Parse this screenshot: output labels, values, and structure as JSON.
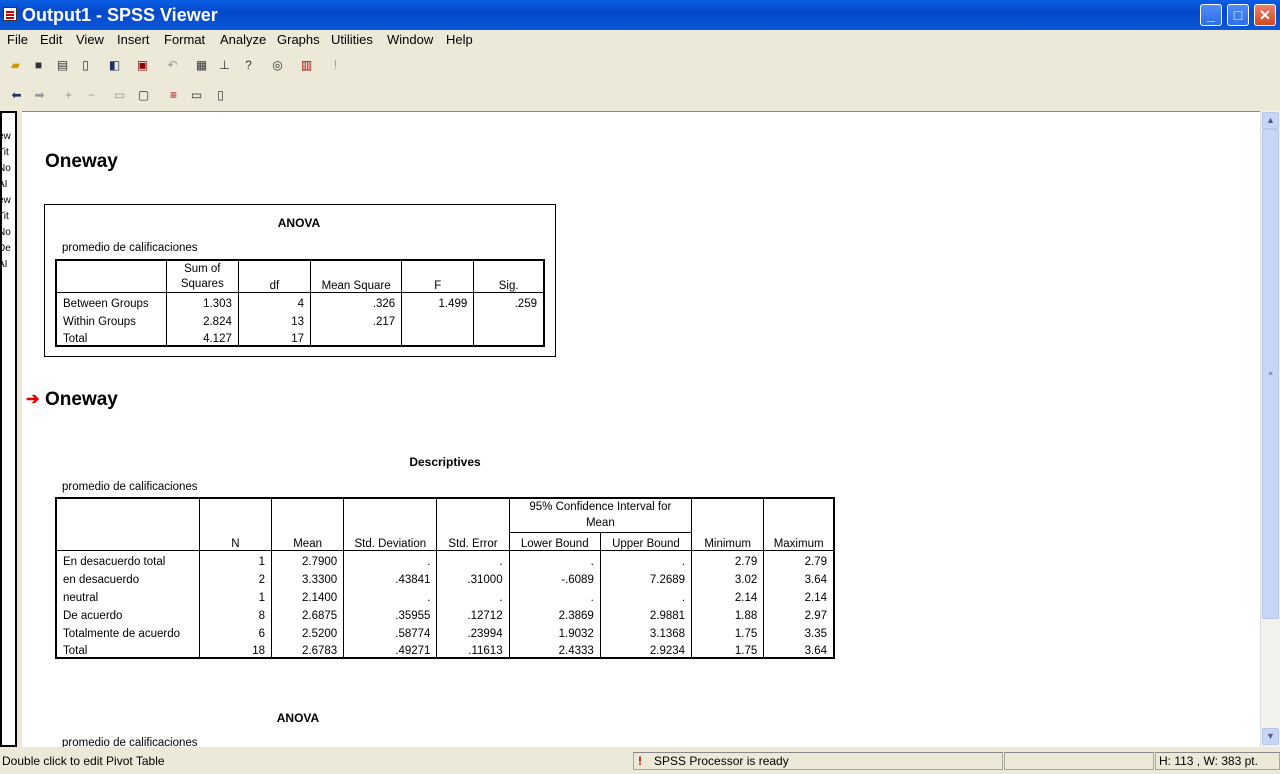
{
  "window": {
    "title": "Output1 - SPSS Viewer",
    "min": "_",
    "max": "□",
    "close": "✕"
  },
  "menu": [
    "File",
    "Edit",
    "View",
    "Insert",
    "Format",
    "Analyze",
    "Graphs",
    "Utilities",
    "Window",
    "Help"
  ],
  "outline": [
    "ew",
    "Tit",
    "No",
    "AI",
    "ew",
    "Tit",
    "No",
    "De",
    "AI"
  ],
  "sections": {
    "first": "Oneway",
    "second": "Oneway"
  },
  "anova1": {
    "title": "ANOVA",
    "subtitle": "promedio de calificaciones",
    "headers": {
      "ss": "Sum of\nSquares",
      "ss1": "Sum of",
      "ss2": "Squares",
      "df": "df",
      "ms": "Mean Square",
      "f": "F",
      "sig": "Sig."
    },
    "rows": [
      {
        "label": "Between Groups",
        "ss": "1.303",
        "df": "4",
        "ms": ".326",
        "f": "1.499",
        "sig": ".259"
      },
      {
        "label": "Within Groups",
        "ss": "2.824",
        "df": "13",
        "ms": ".217",
        "f": "",
        "sig": ""
      },
      {
        "label": "Total",
        "ss": "4.127",
        "df": "17",
        "ms": "",
        "f": "",
        "sig": ""
      }
    ]
  },
  "descriptives": {
    "title": "Descriptives",
    "subtitle": "promedio de calificaciones",
    "headers": {
      "n": "N",
      "mean": "Mean",
      "sd": "Std. Deviation",
      "se": "Std. Error",
      "ci1": "95% Confidence Interval for",
      "ci2": "Mean",
      "lb": "Lower Bound",
      "ub": "Upper Bound",
      "min": "Minimum",
      "max": "Maximum"
    },
    "rows": [
      {
        "label": "En desacuerdo total",
        "n": "1",
        "mean": "2.7900",
        "sd": ".",
        "se": ".",
        "lb": ".",
        "ub": ".",
        "min": "2.79",
        "max": "2.79"
      },
      {
        "label": "en desacuerdo",
        "n": "2",
        "mean": "3.3300",
        "sd": ".43841",
        "se": ".31000",
        "lb": "-.6089",
        "ub": "7.2689",
        "min": "3.02",
        "max": "3.64"
      },
      {
        "label": "neutral",
        "n": "1",
        "mean": "2.1400",
        "sd": ".",
        "se": ".",
        "lb": ".",
        "ub": ".",
        "min": "2.14",
        "max": "2.14"
      },
      {
        "label": "De acuerdo",
        "n": "8",
        "mean": "2.6875",
        "sd": ".35955",
        "se": ".12712",
        "lb": "2.3869",
        "ub": "2.9881",
        "min": "1.88",
        "max": "2.97"
      },
      {
        "label": "Totalmente de acuerdo",
        "n": "6",
        "mean": "2.5200",
        "sd": ".58774",
        "se": ".23994",
        "lb": "1.9032",
        "ub": "3.1368",
        "min": "1.75",
        "max": "3.35"
      },
      {
        "label": "Total",
        "n": "18",
        "mean": "2.6783",
        "sd": ".49271",
        "se": ".11613",
        "lb": "2.4333",
        "ub": "2.9234",
        "min": "1.75",
        "max": "3.64"
      }
    ]
  },
  "anova2": {
    "title": "ANOVA",
    "subtitle": "promedio de calificaciones"
  },
  "status": {
    "hint": "Double click to edit Pivot Table",
    "processor": "SPSS Processor  is ready",
    "size": "H: 113 , W: 383  pt."
  }
}
